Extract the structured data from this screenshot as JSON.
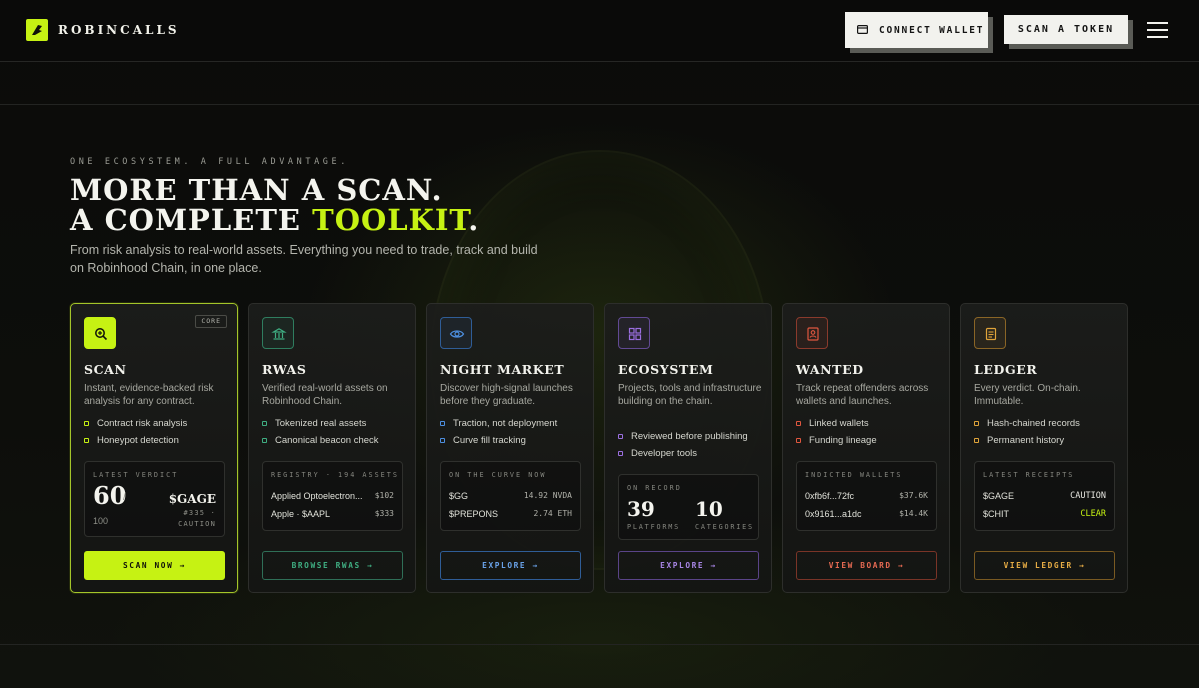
{
  "brand": {
    "name": "ROBINCALLS"
  },
  "header": {
    "connect_wallet": "CONNECT WALLET",
    "scan_token": "SCAN A TOKEN"
  },
  "hero": {
    "eyebrow": "ONE ECOSYSTEM. A FULL ADVANTAGE.",
    "line1": "MORE THAN A SCAN.",
    "line2_pre": "A COMPLETE ",
    "line2_accent": "TOOLKIT",
    "line2_post": ".",
    "subtext": "From risk analysis to real-world assets. Everything you need to trade, track and build on Robinhood Chain, in one place."
  },
  "colors": {
    "accent": "#c6f213",
    "rwas": "#3fae82",
    "night_market": "#4d8fe0",
    "ecosystem": "#9b6fe0",
    "wanted": "#e0573f",
    "ledger": "#e0a43a"
  },
  "cards": {
    "scan": {
      "icon": "magnify-icon",
      "badge": "CORE",
      "title": "SCAN",
      "desc": "Instant, evidence-backed risk analysis for any contract.",
      "features": [
        "Contract risk analysis",
        "Honeypot detection"
      ],
      "panel_label": "LATEST VERDICT",
      "score": "60",
      "score_slash": "/",
      "score_max": "100",
      "token": "$GAGE",
      "token_id": "#335 ·",
      "token_status": "CAUTION",
      "button": "SCAN NOW →"
    },
    "rwas": {
      "icon": "bank-icon",
      "title": "RWAS",
      "desc": "Verified real-world assets on Robinhood Chain.",
      "features": [
        "Tokenized real assets",
        "Canonical beacon check"
      ],
      "panel_label": "REGISTRY · 194 ASSETS",
      "rows": [
        {
          "name": "Applied Optoelectron...",
          "value": "$102"
        },
        {
          "name": "Apple · $AAPL",
          "value": "$333"
        }
      ],
      "button": "BROWSE RWAS →"
    },
    "night_market": {
      "icon": "eye-icon",
      "title": "NIGHT MARKET",
      "desc": "Discover high-signal launches before they graduate.",
      "features": [
        "Traction, not deployment",
        "Curve fill tracking"
      ],
      "panel_label": "ON THE CURVE NOW",
      "rows": [
        {
          "name": "$GG",
          "value": "14.92 NVDA"
        },
        {
          "name": "$PREPONS",
          "value": "2.74 ETH"
        }
      ],
      "button": "EXPLORE →"
    },
    "ecosystem": {
      "icon": "grid-icon",
      "title": "ECOSYSTEM",
      "desc": "Projects, tools and infrastructure building on the chain.",
      "features": [
        "Reviewed before publishing",
        "Developer tools"
      ],
      "panel_label": "ON RECORD",
      "stat1_value": "39",
      "stat1_label": "PLATFORMS",
      "stat2_value": "10",
      "stat2_label": "CATEGORIES",
      "button": "EXPLORE →"
    },
    "wanted": {
      "icon": "id-badge-icon",
      "title": "WANTED",
      "desc": "Track repeat offenders across wallets and launches.",
      "features": [
        "Linked wallets",
        "Funding lineage"
      ],
      "panel_label": "INDICTED WALLETS",
      "rows": [
        {
          "name": "0xfb6f...72fc",
          "value": "$37.6K"
        },
        {
          "name": "0x9161...a1dc",
          "value": "$14.4K"
        }
      ],
      "button": "VIEW BOARD →"
    },
    "ledger": {
      "icon": "ledger-icon",
      "title": "LEDGER",
      "desc": "Every verdict. On-chain. Immutable.",
      "features": [
        "Hash-chained records",
        "Permanent history"
      ],
      "panel_label": "LATEST RECEIPTS",
      "rows": [
        {
          "name": "$GAGE",
          "value": "CAUTION"
        },
        {
          "name": "$CHIT",
          "value": "CLEAR"
        }
      ],
      "button": "VIEW LEDGER →"
    }
  }
}
